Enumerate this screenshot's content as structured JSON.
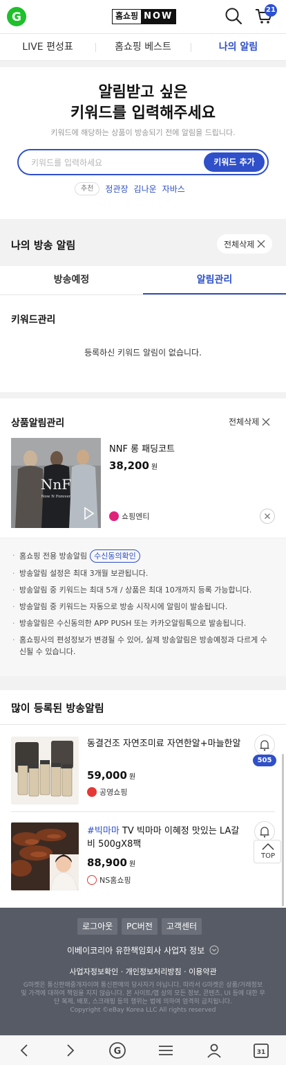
{
  "header": {
    "logo_letter": "G",
    "brand_left": "홈쇼핑",
    "brand_right": "NOW",
    "cart_count": "21"
  },
  "nav": {
    "tabs": [
      "LIVE 편성표",
      "홈쇼핑 베스트",
      "나의 알림"
    ],
    "active_index": 2
  },
  "keyword_section": {
    "title_line1": "알림받고 싶은",
    "title_line2": "키워드를 입력해주세요",
    "subtitle": "키워드에 해당하는 상품이 방송되기 전에 알림을 드립니다.",
    "input_placeholder": "키워드를 입력하세요",
    "input_value": "",
    "add_button": "키워드 추가",
    "recommend_tag": "추천",
    "recommended": [
      "정관장",
      "김나운",
      "자바스"
    ]
  },
  "my_alarm": {
    "title": "나의 방송 알림",
    "delete_all": "전체삭제",
    "tabs": [
      "방송예정",
      "알림관리"
    ],
    "active_tab": 1
  },
  "keyword_manage": {
    "title": "키워드관리",
    "empty_message": "등록하신 키워드 알림이 없습니다."
  },
  "product_manage": {
    "title": "상품알림관리",
    "delete_all": "전체삭제",
    "item": {
      "name": "NNF 롱 패딩코트",
      "price": "38,200",
      "currency": "원",
      "shop": "쇼핑엔티",
      "image_brand": "NnF",
      "image_tagline": "Now N Forever"
    }
  },
  "notice": {
    "items": [
      "홈쇼핑 전용 방송알림",
      "방송알림 설정은 최대 3개월 보관됩니다.",
      "방송알림 중 키워드는 최대 5개 / 상품은 최대 10개까지 등록 가능합니다.",
      "방송알림 중 키워드는 자동으로 방송 시작시에 알림이 발송됩니다.",
      "방송알림은 수신동의한 APP PUSH 또는 카카오알림톡으로 발송됩니다.",
      "홈쇼핑사의 편성정보가 변경될 수 있어, 실제 방송알림은 방송예정과 다르게 수신될 수 있습니다."
    ],
    "consent_button": "수신동의확인"
  },
  "popular": {
    "title": "많이 등록된 방송알림",
    "items": [
      {
        "hashtag": "",
        "name": "동결건조 자연조미료 자연한알+마늘한알",
        "price": "59,000",
        "currency": "원",
        "shop": "공영쇼핑",
        "bell_count": "505"
      },
      {
        "hashtag": "#빅마마",
        "name": " TV 빅마마 이혜정 맛있는 LA갈비 500gX8팩",
        "price": "88,900",
        "currency": "원",
        "shop": "NS홈쇼핑",
        "bell_count": ""
      }
    ],
    "top_button": "TOP"
  },
  "footer": {
    "buttons": [
      "로그아웃",
      "PC버전",
      "고객센터"
    ],
    "company": "이베이코리아 유한책임회사 사업자 정보",
    "links": "사업자정보확인 · 개인정보처리방침 · 이용약관",
    "legal": "G마켓은 통신판매중개자이며 통신판매의 당사자가 아닙니다. 따라서 G마켓은 상품/거래정보 및 가격에 대하여 책임을 지지 않습니다. 본 사이트/앱 상의 모든 정보, 콘텐츠, UI 등에 대한 무단 복제, 배포, 스크래핑 등의 행위는 법에 의하여 엄격히 금지됩니다.",
    "copyright": "Copyright ©eBay Korea LLC All rights reserved"
  },
  "bottom_bar": {
    "icons": [
      "back-arrow-icon",
      "forward-arrow-icon",
      "gmarket-home-icon",
      "menu-icon",
      "my-page-icon",
      "tabs-icon"
    ],
    "tab_count": "31"
  },
  "colors": {
    "accent": "#2c4fc7",
    "brand_green": "#1ec02b",
    "footer_bg": "#575b65"
  }
}
